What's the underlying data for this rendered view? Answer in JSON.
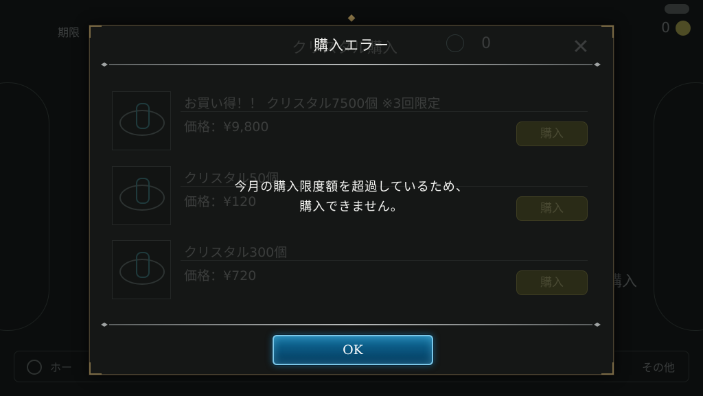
{
  "background": {
    "top_left_text": "期限",
    "top_right_count": "0",
    "right_purchase_label": "購入",
    "bottom_left_label": "ホー",
    "bottom_right_label": "その他"
  },
  "shop": {
    "title": "クリスタル購入",
    "crystal_count": "0",
    "products": [
      {
        "name": "お買い得！！ クリスタル7500個 ※3回限定",
        "price": "価格：¥9,800",
        "buy_label": "購入"
      },
      {
        "name": "クリスタル50個",
        "price": "価格：¥120",
        "buy_label": "購入"
      },
      {
        "name": "クリスタル300個",
        "price": "価格：¥720",
        "buy_label": "購入"
      }
    ]
  },
  "dialog": {
    "title": "購入エラー",
    "message_line1": "今月の購入限度額を超過しているため、",
    "message_line2": "購入できません。",
    "ok_label": "OK"
  },
  "colors": {
    "ok_button": "#0b5a84",
    "ok_border": "#7cc7e8",
    "frame_gold": "#7a6a45"
  },
  "icons": [
    "home-icon",
    "crystal-icon",
    "close-icon",
    "gold-coin-icon"
  ]
}
